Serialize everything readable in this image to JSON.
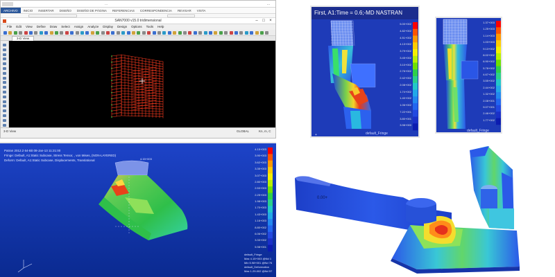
{
  "top_left_window": {
    "ribbon_tabs": [
      "ARCHIVO",
      "INICIO",
      "INSERTAR",
      "DISEÑO",
      "DISEÑO DE PÁGINA",
      "REFERENCIAS",
      "CORRESPONDENCIA",
      "REVISAR",
      "VISTA"
    ],
    "ribbon_doc_title": "...",
    "ribbon_user": "...",
    "window_title": "SAN7000 v15.0 tridimensional",
    "menu_items": [
      "File",
      "Edit",
      "View",
      "Define",
      "Draw",
      "Select",
      "Assign",
      "Analyze",
      "Display",
      "Design",
      "Options",
      "Tools",
      "Help"
    ],
    "view_tab": "3-D View",
    "status_left": "3-D View",
    "status_center": "GLOBAL",
    "status_right": "Kn, m, C"
  },
  "panel_a": {
    "header": "First, A1:Time = 0.6;-MD NASTRAN",
    "legend": [
      "5.00+002",
      "4.82+002",
      "4.51+002",
      "4.13+002",
      "3.79+002",
      "3.45+002",
      "3.10+002",
      "2.76+002",
      "2.42+002",
      "2.08+002",
      "1.74+002",
      "1.40+002",
      "1.06+002",
      "7.22+001",
      "3.80+001",
      "3.98+000"
    ],
    "fringe_label": "default_Fringe"
  },
  "panel_b": {
    "legend": [
      "1.37+003",
      "1.25+003",
      "1.14+003",
      "1.03+003",
      "9.13+002",
      "8.02+002",
      "6.90+002",
      "5.78+002",
      "4.67+002",
      "3.55+002",
      "2.44+002",
      "1.32+002",
      "2.08+001",
      "9.07+001",
      "2.46+002",
      "1.77+002"
    ],
    "fringe_label": "default_Fringe"
  },
  "panel_c": {
    "info_lines": [
      "Patran 2012.2 64-Bit 08-Jan-13 11:21:00",
      "Fringe: Default, A1:Static Subcase, Stress Tensor, , von Mises, (NON-LAYERED)",
      "Deform: Default, A1:Static Subcase, Displacements, Translational"
    ],
    "legend": [
      "4.15+003",
      "3.90+003",
      "3.62+003",
      "3.35+003",
      "3.07+003",
      "2.80+003",
      "2.53+003",
      "2.25+003",
      "1.98+003",
      "1.70+003",
      "1.43+003",
      "1.16+003",
      "8.80+002",
      "6.06+002",
      "3.33+002",
      "5.98+001"
    ],
    "mark_label": "4.15+003",
    "bottom_info": [
      "default_Fringe",
      "Max 4.15+003 @Nd 1",
      "Min 5.98+001 @Nd 76",
      "default_Deformation",
      "Max 1.29-002 @Nd 57"
    ]
  },
  "panel_d": {
    "mark_label": "0.00+"
  },
  "colors": {
    "viewport": "#000000",
    "fem_blue": "#1e3bb8",
    "mesh_red": "#ff3b1f"
  }
}
